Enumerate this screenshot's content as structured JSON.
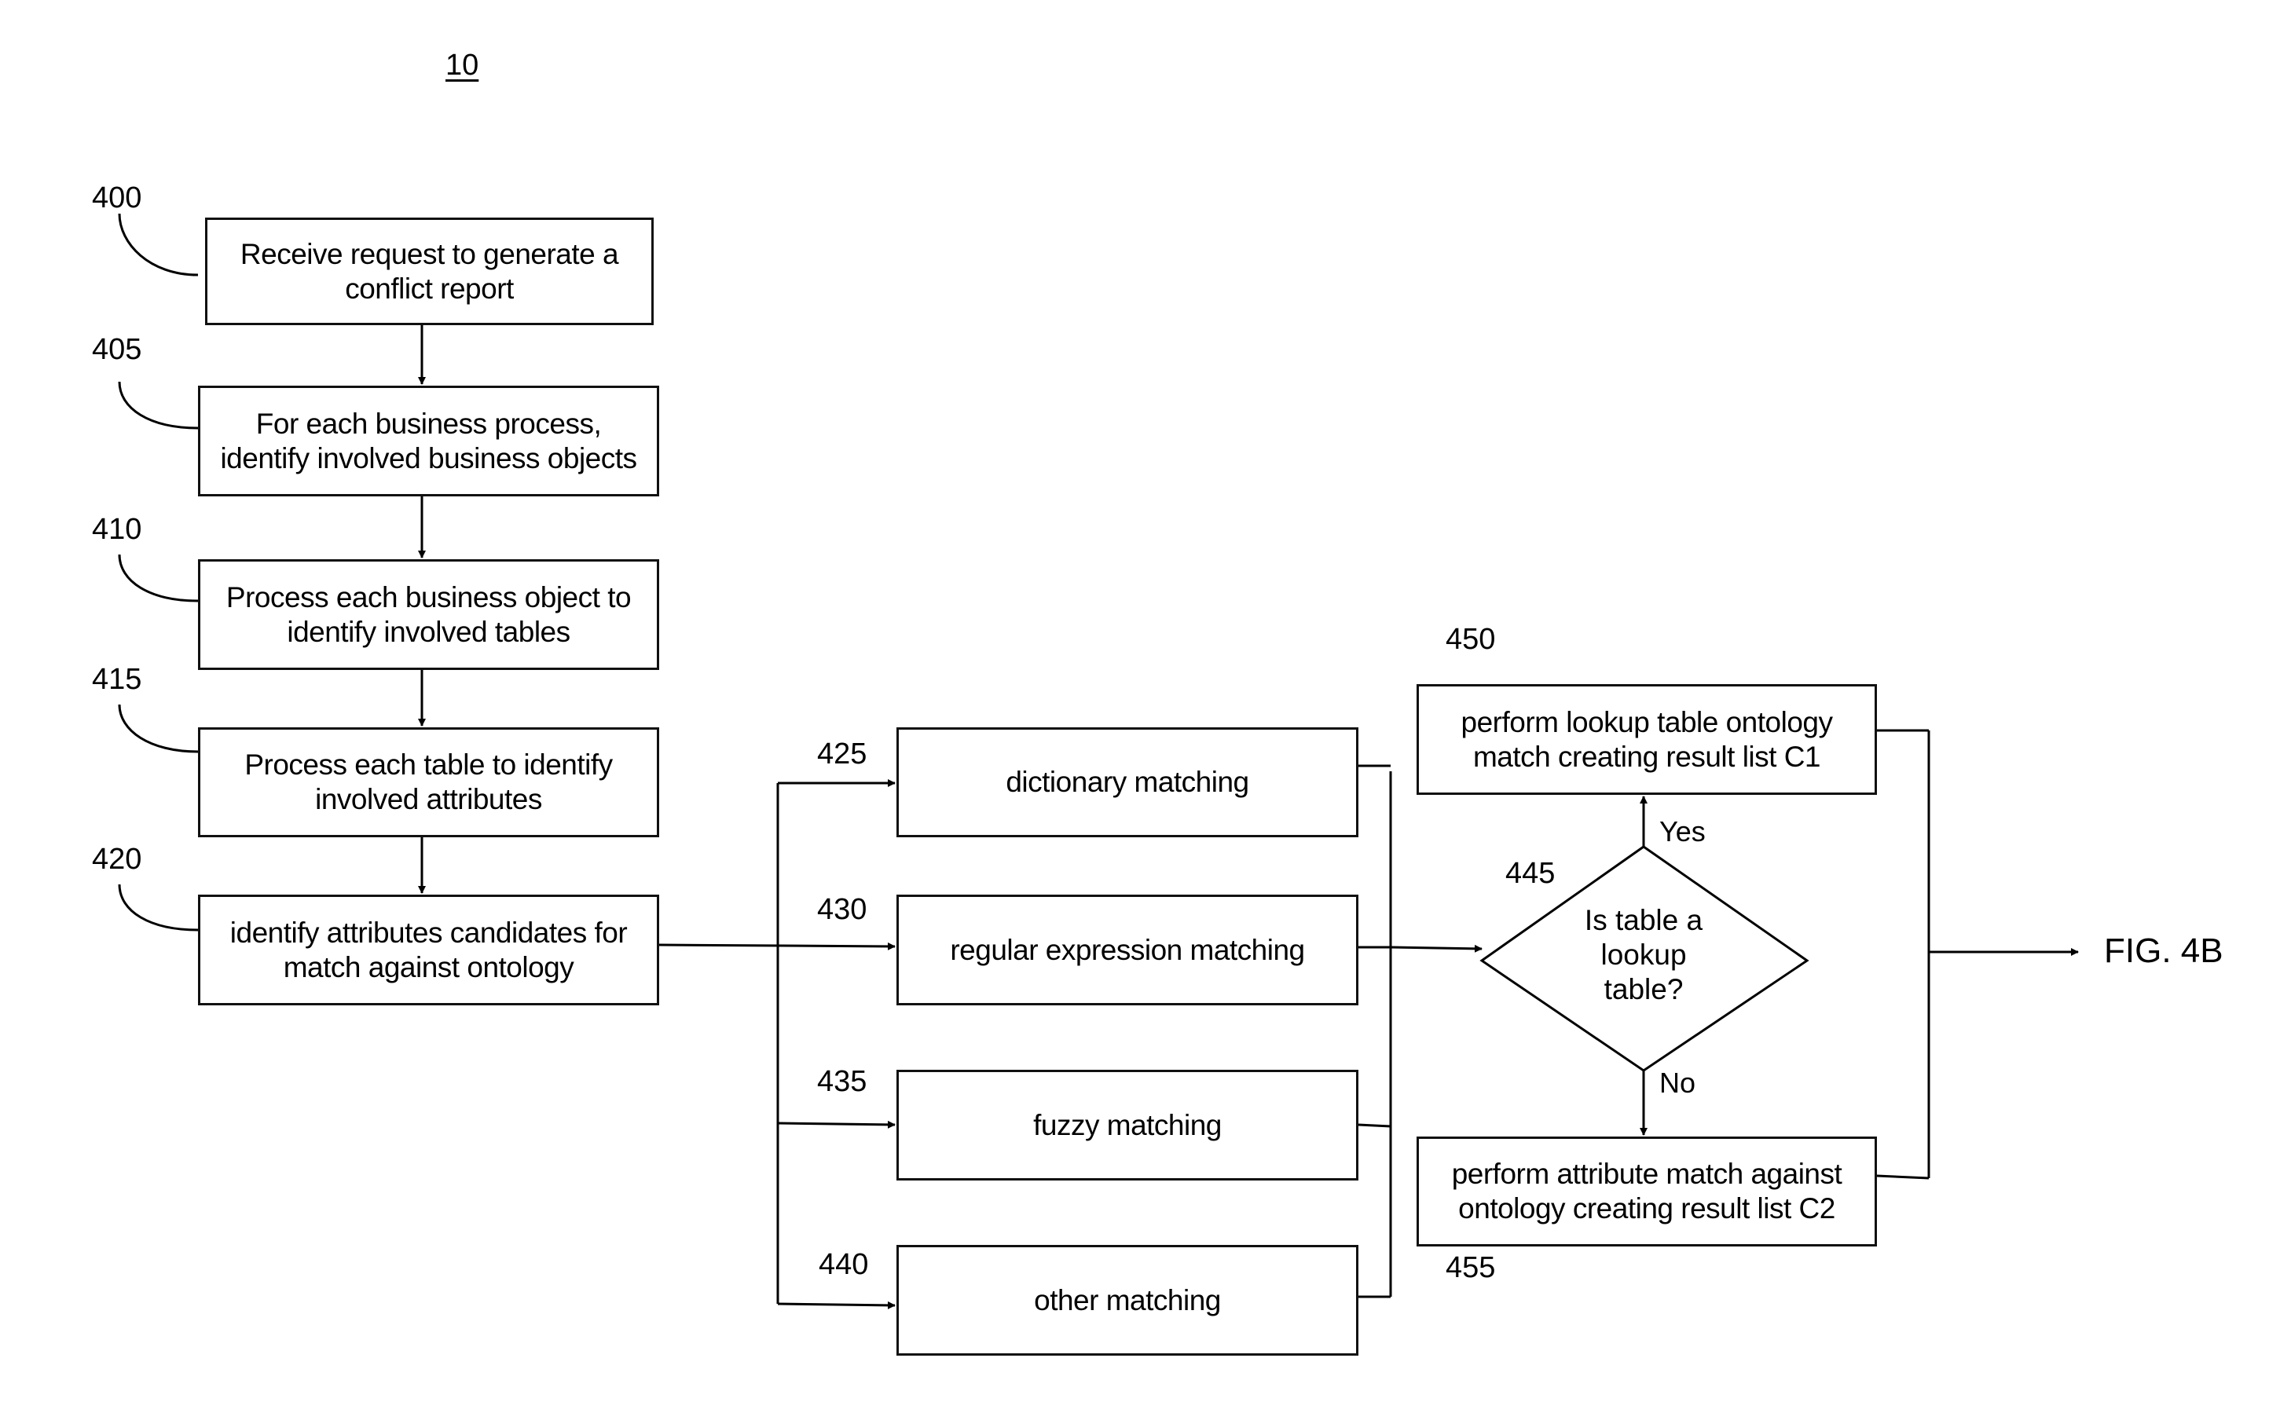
{
  "figure": {
    "number": "10",
    "offpage_connector": "FIG. 4B"
  },
  "steps": [
    {
      "ref": "400",
      "text": "Receive request to generate a\nconflict report"
    },
    {
      "ref": "405",
      "text": "For each business process,\nidentify involved business objects"
    },
    {
      "ref": "410",
      "text": "Process each business object to\nidentify involved tables"
    },
    {
      "ref": "415",
      "text": "Process each table to identify\ninvolved attributes"
    },
    {
      "ref": "420",
      "text": "identify attributes candidates for\nmatch against ontology"
    }
  ],
  "matchers": [
    {
      "ref": "425",
      "text": "dictionary matching"
    },
    {
      "ref": "430",
      "text": "regular expression matching"
    },
    {
      "ref": "435",
      "text": "fuzzy matching"
    },
    {
      "ref": "440",
      "text": "other matching"
    }
  ],
  "decision": {
    "ref": "445",
    "text": "Is table  a\nlookup\ntable?",
    "yes_label": "Yes",
    "no_label": "No"
  },
  "outcomes": {
    "yes": {
      "ref": "450",
      "text": "perform lookup table ontology\nmatch creating result list C1"
    },
    "no": {
      "ref": "455",
      "text": "perform attribute match against\nontology creating result list C2"
    }
  }
}
